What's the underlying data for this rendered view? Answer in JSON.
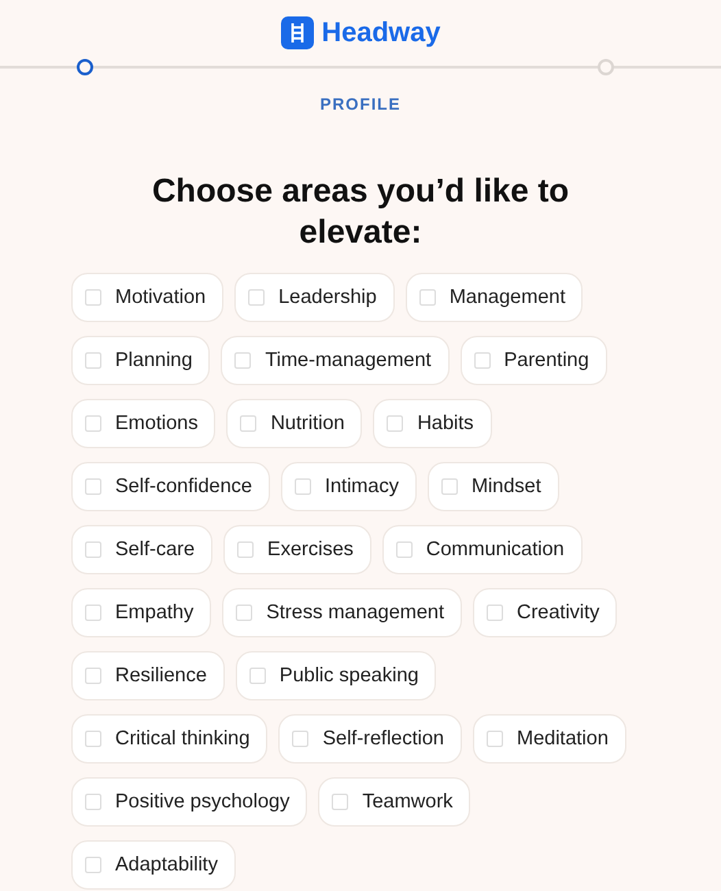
{
  "brand": "Headway",
  "progress": {
    "steps": [
      {
        "selected": true
      },
      {
        "selected": false
      }
    ]
  },
  "step_label": "PROFILE",
  "title": "Choose areas you’d like to elevate:",
  "area_rows": [
    [
      {
        "label": "Motivation",
        "checked": false
      },
      {
        "label": "Leadership",
        "checked": false
      },
      {
        "label": "Management",
        "checked": false
      }
    ],
    [
      {
        "label": "Planning",
        "checked": false
      },
      {
        "label": "Time-management",
        "checked": false
      },
      {
        "label": "Parenting",
        "checked": false
      }
    ],
    [
      {
        "label": "Emotions",
        "checked": false
      },
      {
        "label": "Nutrition",
        "checked": false
      },
      {
        "label": "Habits",
        "checked": false
      }
    ],
    [
      {
        "label": "Self-confidence",
        "checked": false
      },
      {
        "label": "Intimacy",
        "checked": false
      },
      {
        "label": "Mindset",
        "checked": false
      }
    ],
    [
      {
        "label": "Self-care",
        "checked": false
      },
      {
        "label": "Exercises",
        "checked": false
      },
      {
        "label": "Communication",
        "checked": false
      }
    ],
    [
      {
        "label": "Empathy",
        "checked": false
      },
      {
        "label": "Stress management",
        "checked": false
      },
      {
        "label": "Creativity",
        "checked": false
      }
    ],
    [
      {
        "label": "Resilience",
        "checked": false
      },
      {
        "label": "Public speaking",
        "checked": false
      }
    ],
    [
      {
        "label": "Critical thinking",
        "checked": false
      },
      {
        "label": "Self-reflection",
        "checked": false
      },
      {
        "label": "Meditation",
        "checked": false
      }
    ],
    [
      {
        "label": "Positive psychology",
        "checked": false
      },
      {
        "label": "Teamwork",
        "checked": false
      }
    ],
    [
      {
        "label": "Adaptability",
        "checked": false
      }
    ]
  ]
}
